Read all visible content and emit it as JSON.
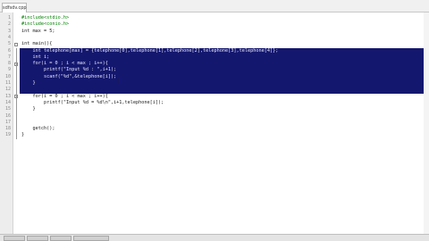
{
  "tab": {
    "label": "sdfsdv.cpp"
  },
  "lines": [
    {
      "num": "1",
      "text": "#include<stdio.h>",
      "cls": "pp",
      "selected": false
    },
    {
      "num": "2",
      "text": "#include<conio.h>",
      "cls": "pp",
      "selected": false
    },
    {
      "num": "3",
      "text": "int max = 5;",
      "cls": "",
      "selected": false
    },
    {
      "num": "4",
      "text": "",
      "cls": "",
      "selected": false
    },
    {
      "num": "5",
      "text": "int main(){",
      "cls": "",
      "selected": false
    },
    {
      "num": "6",
      "text": "    int telephone[max] = {telephone[0],telephone[1],telephone[2],telephone[3],telephone[4]};",
      "cls": "",
      "selected": true
    },
    {
      "num": "7",
      "text": "    int i;",
      "cls": "",
      "selected": true
    },
    {
      "num": "8",
      "text": "    for(i = 0 ; i < max ; i++){",
      "cls": "",
      "selected": true
    },
    {
      "num": "9",
      "text": "        printf(\"Input %d : \",i+1);",
      "cls": "",
      "selected": true
    },
    {
      "num": "10",
      "text": "        scanf(\"%d\",&telephone[i]);",
      "cls": "",
      "selected": true
    },
    {
      "num": "11",
      "text": "    }",
      "cls": "",
      "selected": true
    },
    {
      "num": "12",
      "text": "",
      "cls": "",
      "selected": true
    },
    {
      "num": "13",
      "text": "    for(i = 0 ; i < max ; i++){",
      "cls": "",
      "selected": false
    },
    {
      "num": "14",
      "text": "        printf(\"Input %d = %d\\n\",i+1,telephone[i]);",
      "cls": "",
      "selected": false
    },
    {
      "num": "15",
      "text": "    }",
      "cls": "",
      "selected": false
    },
    {
      "num": "16",
      "text": "",
      "cls": "",
      "selected": false
    },
    {
      "num": "17",
      "text": "",
      "cls": "",
      "selected": false
    },
    {
      "num": "18",
      "text": "    getch();",
      "cls": "",
      "selected": false
    },
    {
      "num": "19",
      "text": "}",
      "cls": "",
      "selected": false
    }
  ],
  "colors": {
    "selection": "#14176e",
    "gutter": "#ededed",
    "preprocessor": "#008000"
  }
}
